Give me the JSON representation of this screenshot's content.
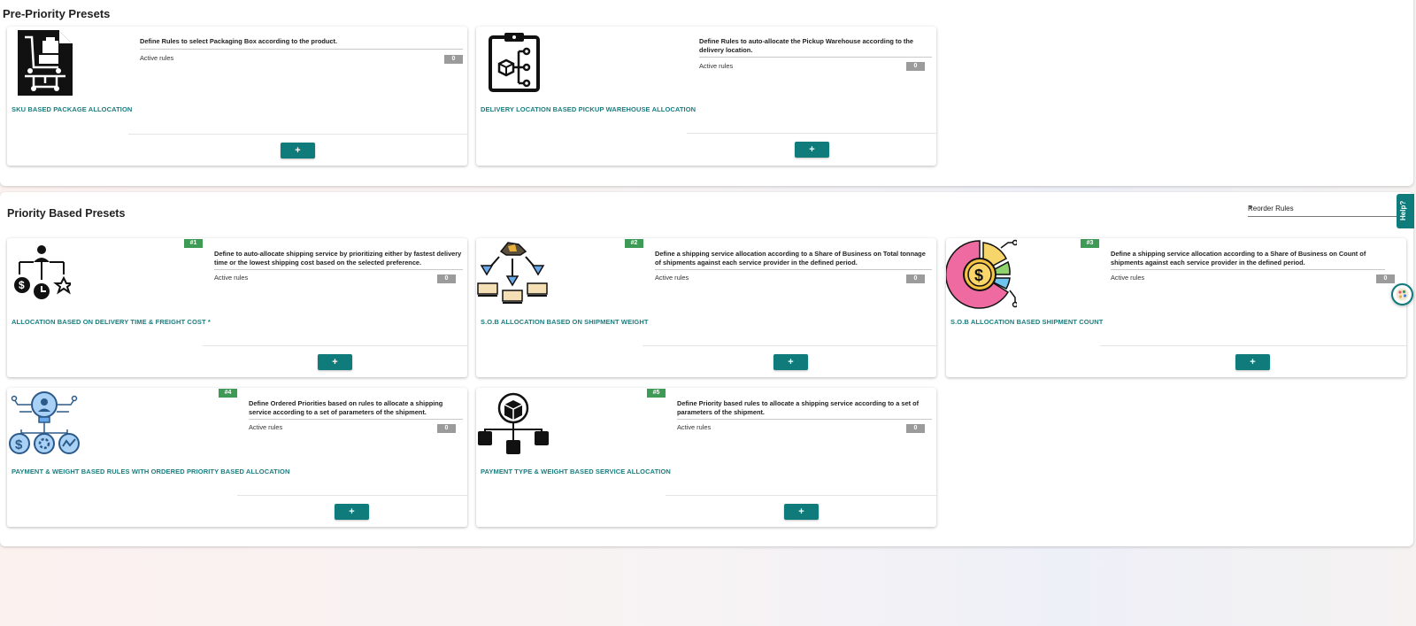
{
  "pre_priority": {
    "title": "Pre-Priority Presets",
    "cards": [
      {
        "title": "SKU BASED PACKAGE ALLOCATION",
        "description": "Define Rules to select Packaging Box according to the product.",
        "active_label": "Active rules",
        "active_count": "0",
        "add_label": "+",
        "icon": "sku-package-icon"
      },
      {
        "title": "DELIVERY LOCATION BASED PICKUP WAREHOUSE ALLOCATION",
        "description": "Define Rules to auto-allocate the Pickup Warehouse according to the delivery location.",
        "active_label": "Active rules",
        "active_count": "0",
        "add_label": "+",
        "icon": "clipboard-icon"
      }
    ]
  },
  "priority": {
    "title": "Priority Based Presets",
    "reorder_label": "Reorder Rules",
    "cards": [
      {
        "badge": "#1",
        "title": "ALLOCATION BASED ON DELIVERY TIME & FREIGHT COST *",
        "description": "Define to auto-allocate shipping service by prioritizing either by fastest delivery time or the lowest shipping cost based on the selected preference.",
        "active_label": "Active rules",
        "active_count": "0",
        "add_label": "+",
        "icon": "person-cost-time-icon"
      },
      {
        "badge": "#2",
        "title": "S.O.B ALLOCATION BASED ON SHIPMENT WEIGHT",
        "description": "Define a shipping service allocation according to a Share of Business on Total tonnage of shipments against each service provider in the defined period.",
        "active_label": "Active rules",
        "active_count": "0",
        "add_label": "+",
        "icon": "weight-distribution-icon"
      },
      {
        "badge": "#3",
        "title": "S.O.B ALLOCATION BASED SHIPMENT COUNT",
        "description": "Define a shipping service allocation according to a Share of Business on Count of shipments against each service provider in the defined period.",
        "active_label": "Active rules",
        "active_count": "0",
        "add_label": "+",
        "icon": "dollar-pie-icon"
      },
      {
        "badge": "#4",
        "title": "PAYMENT & WEIGHT BASED RULES WITH ORDERED PRIORITY BASED ALLOCATION",
        "description": "Define Ordered Priorities based on rules to allocate a shipping service according to a set of parameters of the shipment.",
        "active_label": "Active rules",
        "active_count": "0",
        "add_label": "+",
        "icon": "idea-network-icon"
      },
      {
        "badge": "#5",
        "title": "PAYMENT TYPE & WEIGHT BASED SERVICE ALLOCATION",
        "description": "Define Priority based rules to allocate a shipping service according to a set of parameters of the shipment.",
        "active_label": "Active rules",
        "active_count": "0",
        "add_label": "+",
        "icon": "box-network-icon"
      }
    ]
  },
  "help_label": "Help?",
  "colors": {
    "accent": "#0f7b7a",
    "badge": "#3d9b55",
    "count": "#9b9b9b"
  }
}
